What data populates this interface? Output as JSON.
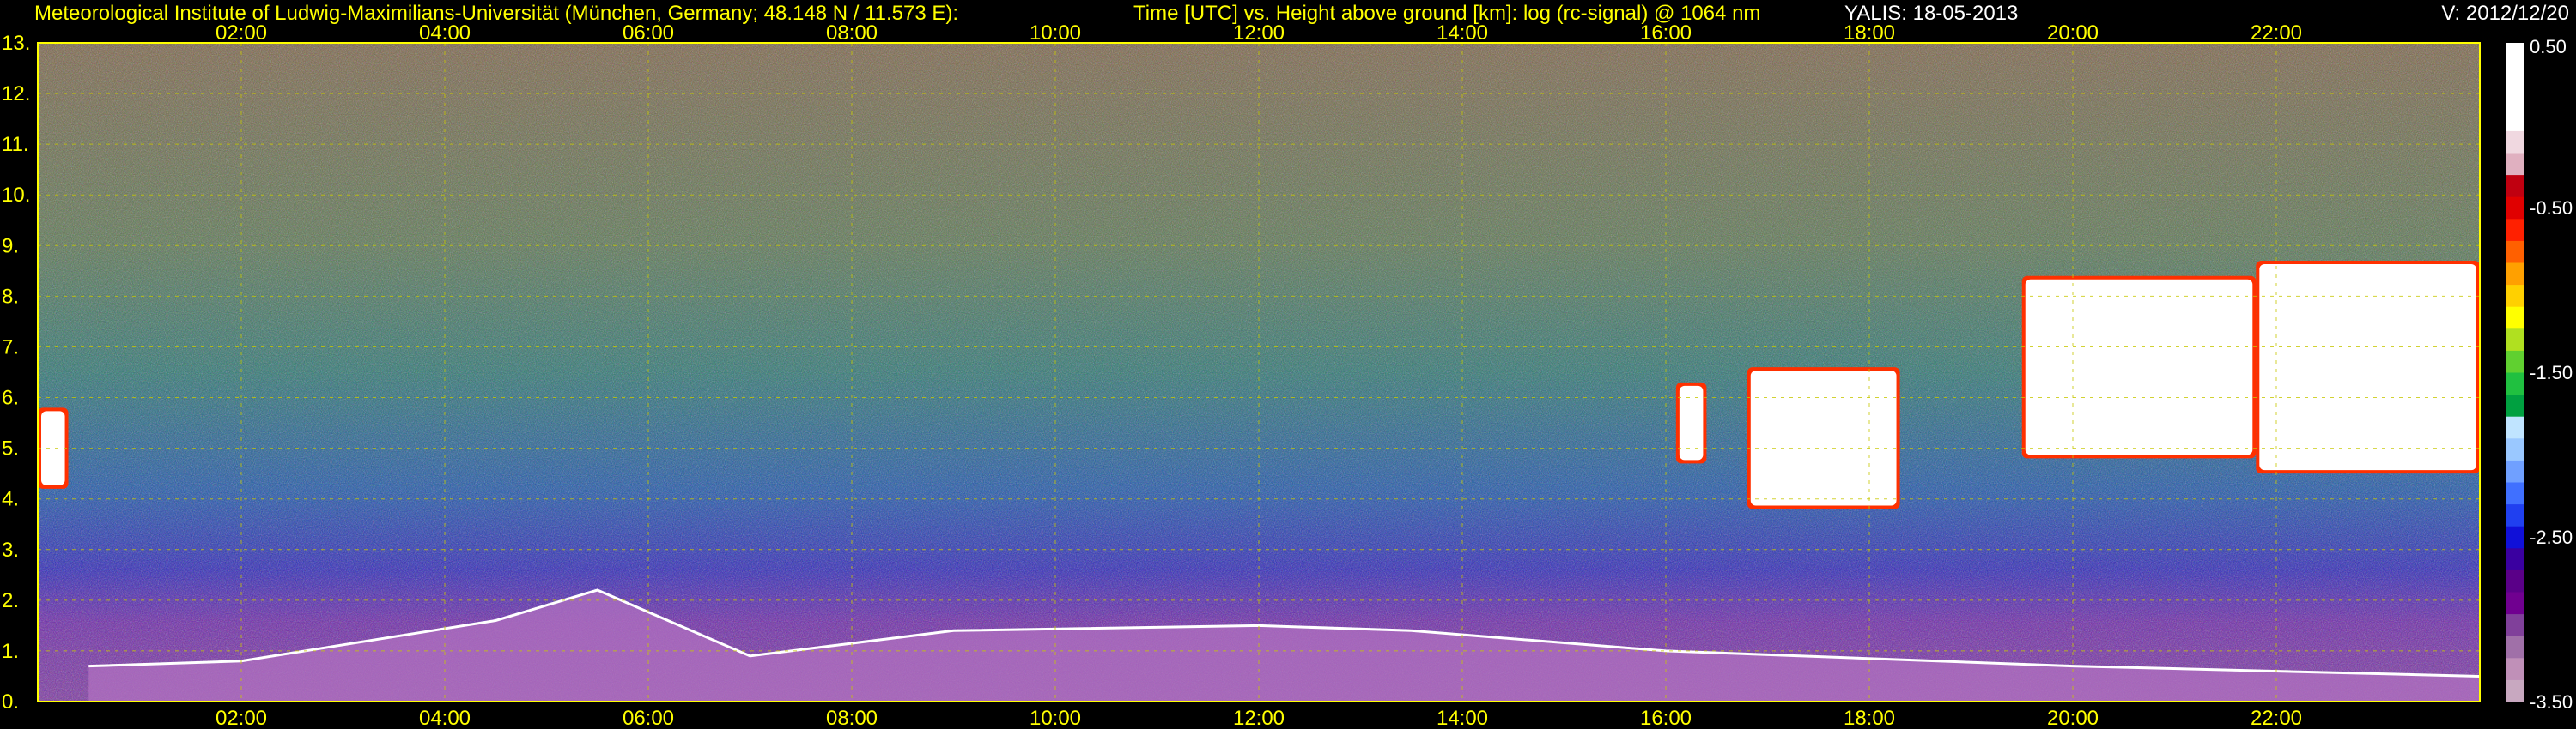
{
  "header": {
    "institution": "Meteorological Institute of Ludwig-Maximilians-Universität (München, Germany; 48.148 N / 11.573 E):",
    "description": "Time [UTC] vs. Height above ground [km]: log (rc-signal) @ 1064 nm",
    "site_date": "YALIS: 18-05-2013",
    "version": "V: 2012/12/20"
  },
  "chart_data": {
    "type": "heatmap",
    "title": "Time [UTC] vs. Height above ground [km]: log (rc-signal) @ 1064 nm",
    "x_range_hours": [
      0,
      24
    ],
    "x_ticks": [
      "02:00",
      "04:00",
      "06:00",
      "08:00",
      "10:00",
      "12:00",
      "14:00",
      "16:00",
      "18:00",
      "20:00",
      "22:00"
    ],
    "x_tick_hours": [
      2,
      4,
      6,
      8,
      10,
      12,
      14,
      16,
      18,
      20,
      22
    ],
    "y_range_km": [
      0,
      13
    ],
    "y_ticks": [
      "0.",
      "1.",
      "2.",
      "3.",
      "4.",
      "5.",
      "6.",
      "7.",
      "8.",
      "9.",
      "10.",
      "11.",
      "12.",
      "13."
    ],
    "y_tick_values": [
      0,
      1,
      2,
      3,
      4,
      5,
      6,
      7,
      8,
      9,
      10,
      11,
      12,
      13
    ],
    "grid": true,
    "colorbar": {
      "range": [
        -3.5,
        0.5
      ],
      "ticks": [
        "0.50",
        "-0.50",
        "-1.50",
        "-2.50",
        "-3.50"
      ],
      "tick_values": [
        0.5,
        -0.5,
        -1.5,
        -2.5,
        -3.5
      ],
      "colors": [
        "#c8a8c0",
        "#c090b8",
        "#a070a8",
        "#80409a",
        "#700090",
        "#5a0088",
        "#3a00a0",
        "#1010d8",
        "#2040f0",
        "#4070ff",
        "#70a0ff",
        "#9ac8ff",
        "#c0e4ff",
        "#00a040",
        "#20c040",
        "#60d030",
        "#b0e020",
        "#ffff00",
        "#ffd000",
        "#ffa000",
        "#ff6000",
        "#ff2000",
        "#e00000",
        "#c00010",
        "#e0b0c0",
        "#f0d8e0",
        "#ffffff",
        "#ffffff",
        "#ffffff",
        "#ffffff"
      ]
    },
    "cloud_layers": [
      {
        "t_start": 0.0,
        "t_end": 0.3,
        "h_base": 4.2,
        "h_top": 5.8
      },
      {
        "t_start": 16.1,
        "t_end": 16.4,
        "h_base": 4.7,
        "h_top": 6.3
      },
      {
        "t_start": 16.8,
        "t_end": 18.3,
        "h_base": 3.8,
        "h_top": 6.6
      },
      {
        "t_start": 19.5,
        "t_end": 21.8,
        "h_base": 4.8,
        "h_top": 8.4
      },
      {
        "t_start": 21.8,
        "t_end": 24.0,
        "h_base": 4.5,
        "h_top": 8.7
      }
    ],
    "boundary_layer_top_km": [
      {
        "t": 0.5,
        "h": 0.7
      },
      {
        "t": 2.0,
        "h": 0.8
      },
      {
        "t": 4.5,
        "h": 1.6
      },
      {
        "t": 5.5,
        "h": 2.2
      },
      {
        "t": 7.0,
        "h": 0.9
      },
      {
        "t": 9.0,
        "h": 1.4
      },
      {
        "t": 12.0,
        "h": 1.5
      },
      {
        "t": 13.5,
        "h": 1.4
      },
      {
        "t": 16.0,
        "h": 1.0
      },
      {
        "t": 20.0,
        "h": 0.7
      },
      {
        "t": 24.0,
        "h": 0.5
      }
    ]
  }
}
